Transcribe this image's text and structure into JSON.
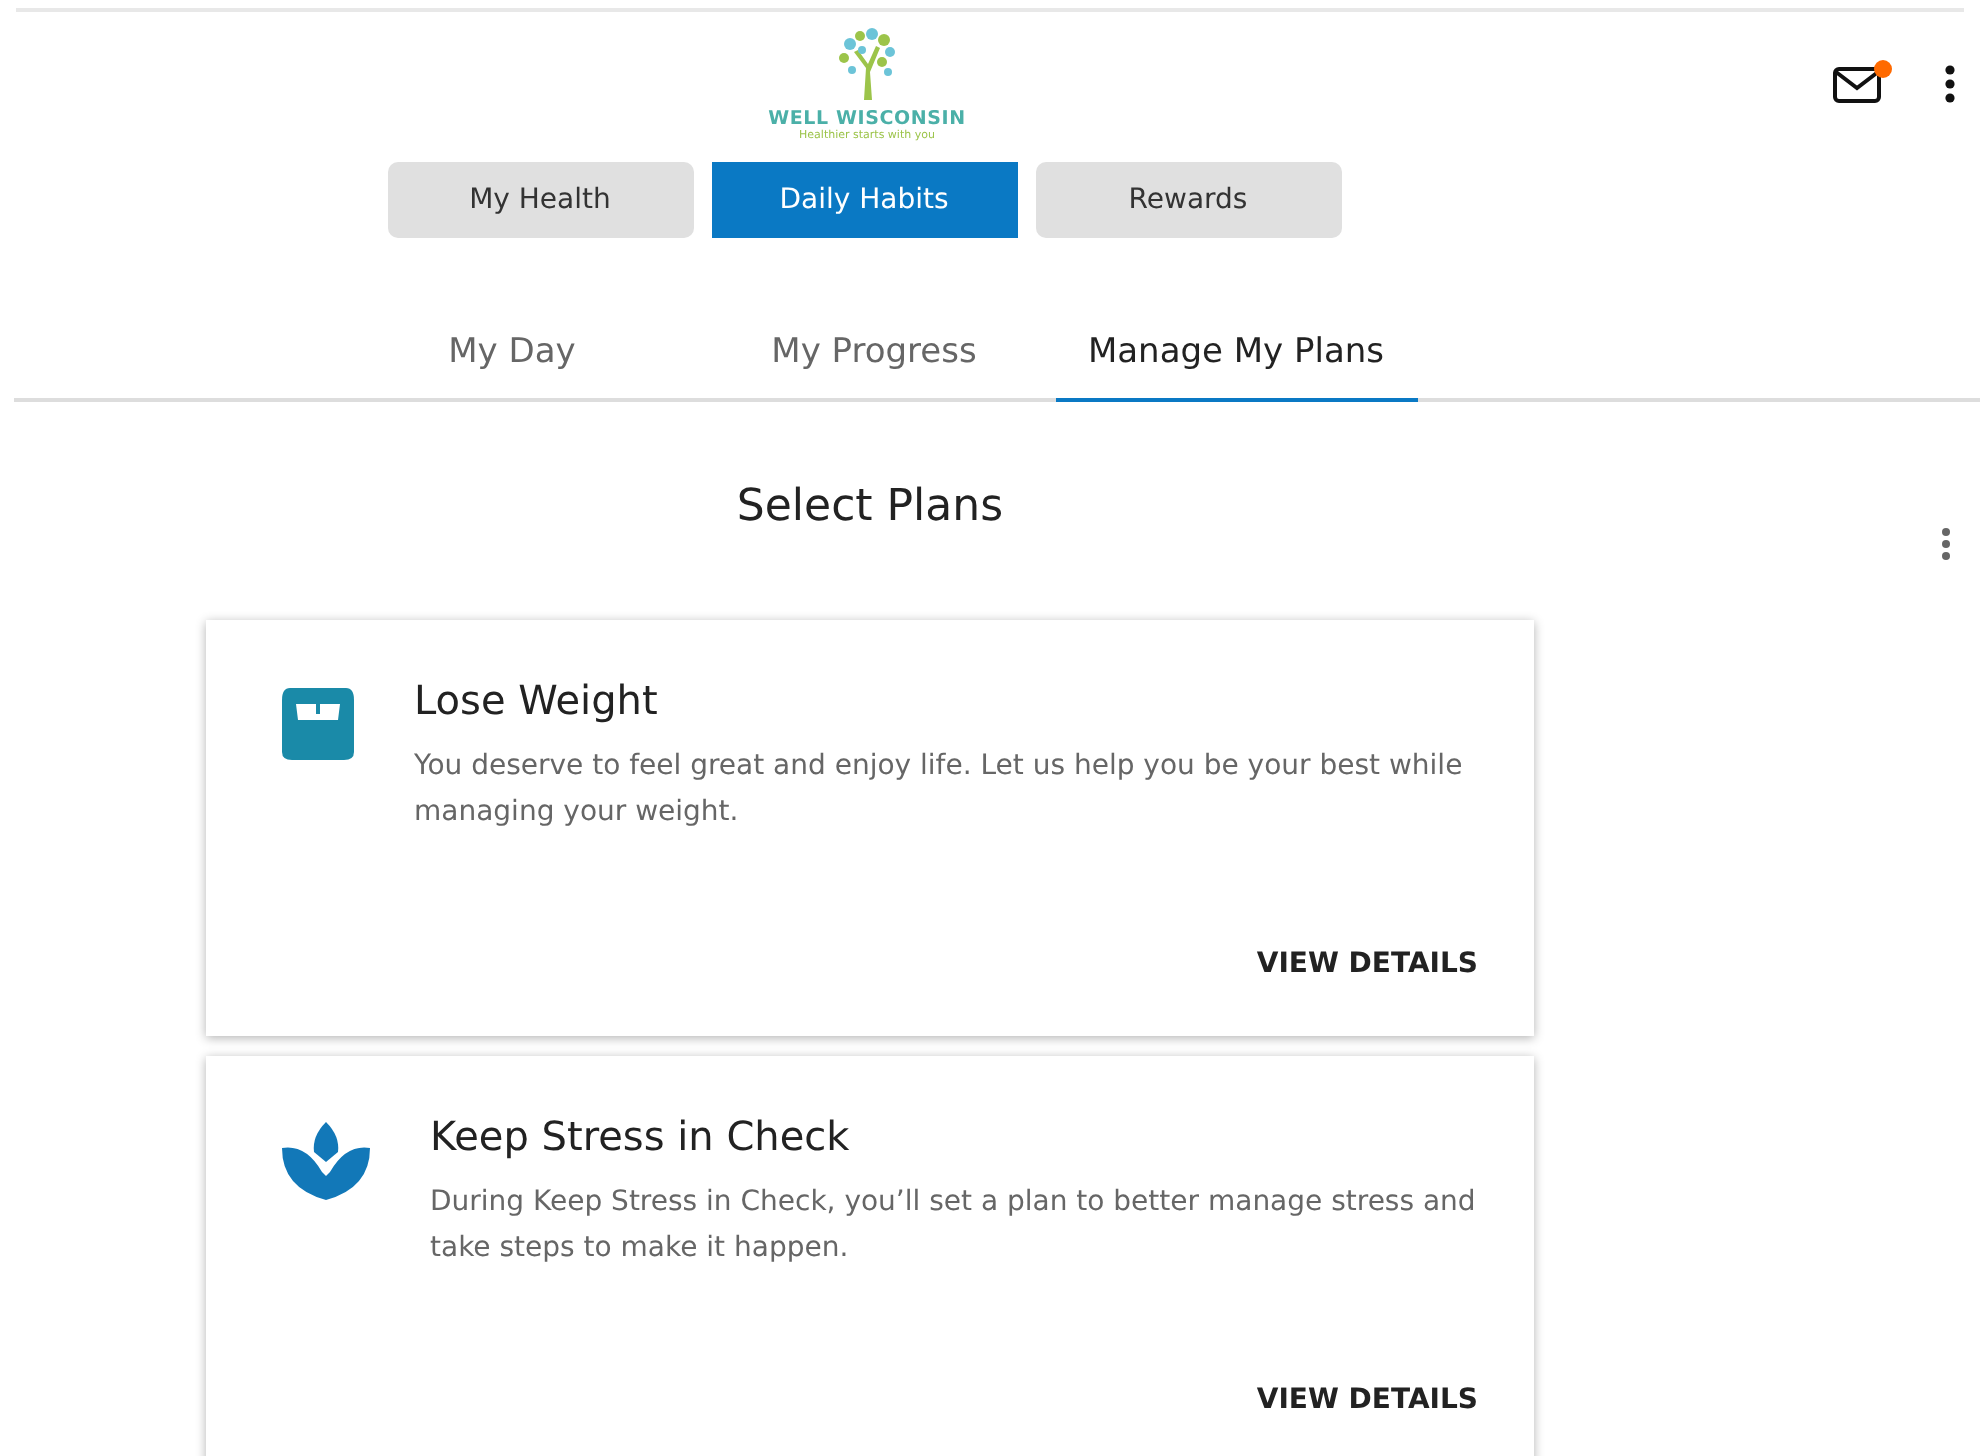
{
  "header": {
    "logo": {
      "name": "WELL WISCONSIN",
      "tagline": "Healthier starts with you"
    },
    "mail": {
      "unread": true
    }
  },
  "tabs": [
    {
      "label": "My Health",
      "selected": false
    },
    {
      "label": "Daily Habits",
      "selected": true
    },
    {
      "label": "Rewards",
      "selected": false
    }
  ],
  "subtabs": [
    {
      "label": "My Day",
      "selected": false
    },
    {
      "label": "My Progress",
      "selected": false
    },
    {
      "label": "Manage My Plans",
      "selected": true
    }
  ],
  "title": "Select Plans",
  "plans": [
    {
      "kind": "scale",
      "name": "Lose Weight",
      "description": "You deserve to feel great and enjoy life. Let us help you be your best while managing your weight.",
      "action": "VIEW DETAILS"
    },
    {
      "kind": "lotus",
      "name": "Keep Stress in Check",
      "description": "During Keep Stress in Check, you’ll set a plan to better manage stress and take steps to make it happen.",
      "action": "VIEW DETAILS"
    }
  ]
}
